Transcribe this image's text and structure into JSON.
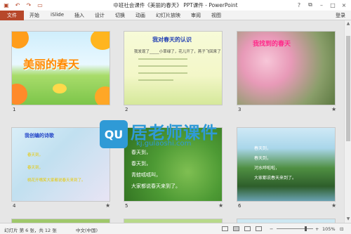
{
  "titlebar": {
    "title": "中班社会课件《美丽的春天》 PPT课件 - PowerPoint",
    "quick_access": [
      "save-icon",
      "undo-icon",
      "redo-icon",
      "present-icon"
    ],
    "help": "?",
    "minimize": "–",
    "maximize": "□",
    "close": "×",
    "options": "⧉"
  },
  "ribbon": {
    "file": "文件",
    "tabs": [
      "开始",
      "iSlide",
      "插入",
      "设计",
      "切换",
      "动画",
      "幻灯片放映",
      "审阅",
      "视图"
    ],
    "login": "登录"
  },
  "slides": [
    {
      "number": "1",
      "title": "美丽的春天"
    },
    {
      "number": "2",
      "title": "我对春天的认识",
      "line": "我发现了_____小草绿了，花儿开了，燕子飞回来了"
    },
    {
      "number": "3",
      "title": "我找到的春天",
      "star": "★"
    },
    {
      "number": "4",
      "title": "我创编的诗歌",
      "lines": [
        "春天到，",
        "春天到，",
        "桃花开嘴笑大家都说春天来到了。"
      ],
      "star": "★"
    },
    {
      "number": "5",
      "lines": [
        "春天到，",
        "春天到，",
        "青蛙呱呱叫，",
        "大家都说春天来到了。"
      ],
      "star": "★"
    },
    {
      "number": "6",
      "lines": [
        "春天到，",
        "春天到，",
        "河水哗啦啦，",
        "大家都说春天来到了。"
      ],
      "star": "★"
    }
  ],
  "watermark": {
    "logo": "QU",
    "text": "居老师课件",
    "url": "kj.gulaoshi.com"
  },
  "statusbar": {
    "slide_info": "幻灯片 第 6 张，共 12 张",
    "language": "中文(中国)",
    "zoom": "105%"
  },
  "colors": {
    "accent": "#b7472a",
    "watermark": "#2f9ad6"
  }
}
